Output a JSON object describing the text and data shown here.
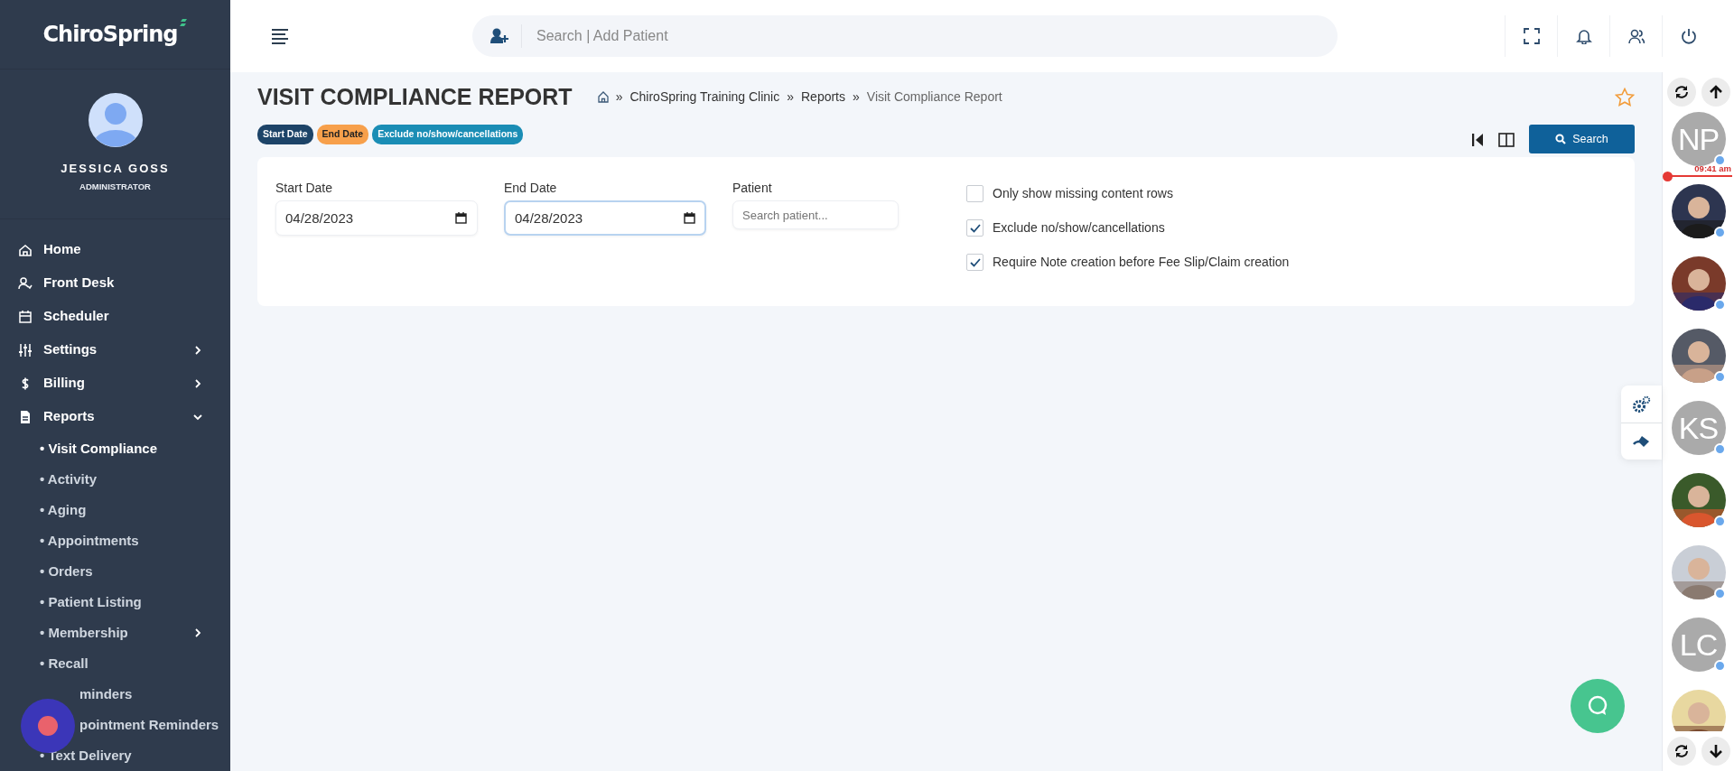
{
  "brand": {
    "name": "ChiroSpring"
  },
  "user": {
    "name": "JESSICA GOSS",
    "role": "ADMINISTRATOR"
  },
  "nav": [
    {
      "label": "Home",
      "kind": "link"
    },
    {
      "label": "Front Desk",
      "kind": "link"
    },
    {
      "label": "Scheduler",
      "kind": "link"
    },
    {
      "label": "Settings",
      "kind": "group",
      "expanded": false
    },
    {
      "label": "Billing",
      "kind": "group",
      "expanded": false
    },
    {
      "label": "Reports",
      "kind": "group",
      "expanded": true,
      "children": [
        {
          "label": "• Visit Compliance",
          "selected": true,
          "kind": "link"
        },
        {
          "label": "• Activity",
          "selected": false,
          "kind": "link"
        },
        {
          "label": "• Aging",
          "selected": false,
          "kind": "link"
        },
        {
          "label": "• Appointments",
          "selected": false,
          "kind": "link"
        },
        {
          "label": "• Orders",
          "selected": false,
          "kind": "link"
        },
        {
          "label": "• Patient Listing",
          "selected": false,
          "kind": "link"
        },
        {
          "label": "• Membership",
          "selected": false,
          "kind": "group",
          "expanded": false
        },
        {
          "label": "• Recall",
          "selected": false,
          "kind": "link"
        },
        {
          "label": "minders",
          "selected": false,
          "kind": "covered"
        },
        {
          "label": "pointment Reminders",
          "selected": false,
          "kind": "covered"
        },
        {
          "label": "• Text Delivery",
          "selected": false,
          "kind": "link"
        }
      ]
    }
  ],
  "search": {
    "placeholder": "Search | Add Patient"
  },
  "page": {
    "title": "VISIT COMPLIANCE REPORT",
    "favorite": false,
    "breadcrumb": [
      {
        "separator": "»",
        "label": "ChiroSpring Training Clinic",
        "current": false
      },
      {
        "separator": "»",
        "label": "Reports",
        "current": false
      },
      {
        "separator": "»",
        "label": "Visit Compliance Report",
        "current": true
      }
    ],
    "filter_badges": [
      {
        "label": "Start Date",
        "color": "#1d4468"
      },
      {
        "label": "End Date",
        "color": "#f7a04b"
      },
      {
        "label": "Exclude no/show/cancellations",
        "color": "#1a8db5"
      }
    ],
    "search_button": "Search"
  },
  "form": {
    "fields": [
      {
        "label": "Start Date",
        "kind": "date",
        "value": "04/28/2023",
        "focused": false
      },
      {
        "label": "End Date",
        "kind": "date",
        "value": "04/28/2023",
        "focused": true
      },
      {
        "label": "Patient",
        "kind": "text",
        "placeholder": "Search patient..."
      }
    ],
    "options": [
      {
        "label": "Only show missing content rows",
        "checked": false
      },
      {
        "label": "Exclude no/show/cancellations",
        "checked": true
      },
      {
        "label": "Require Note creation before Fee Slip/Claim creation",
        "checked": true
      }
    ]
  },
  "schedule_panel": {
    "time": "09:41 am",
    "avatars": [
      {
        "kind": "initials",
        "initials": "NP"
      },
      {
        "kind": "picture"
      },
      {
        "kind": "picture"
      },
      {
        "kind": "picture"
      },
      {
        "kind": "initials",
        "initials": "KS"
      },
      {
        "kind": "picture"
      },
      {
        "kind": "picture"
      },
      {
        "kind": "initials",
        "initials": "LC"
      },
      {
        "kind": "picture"
      }
    ]
  }
}
